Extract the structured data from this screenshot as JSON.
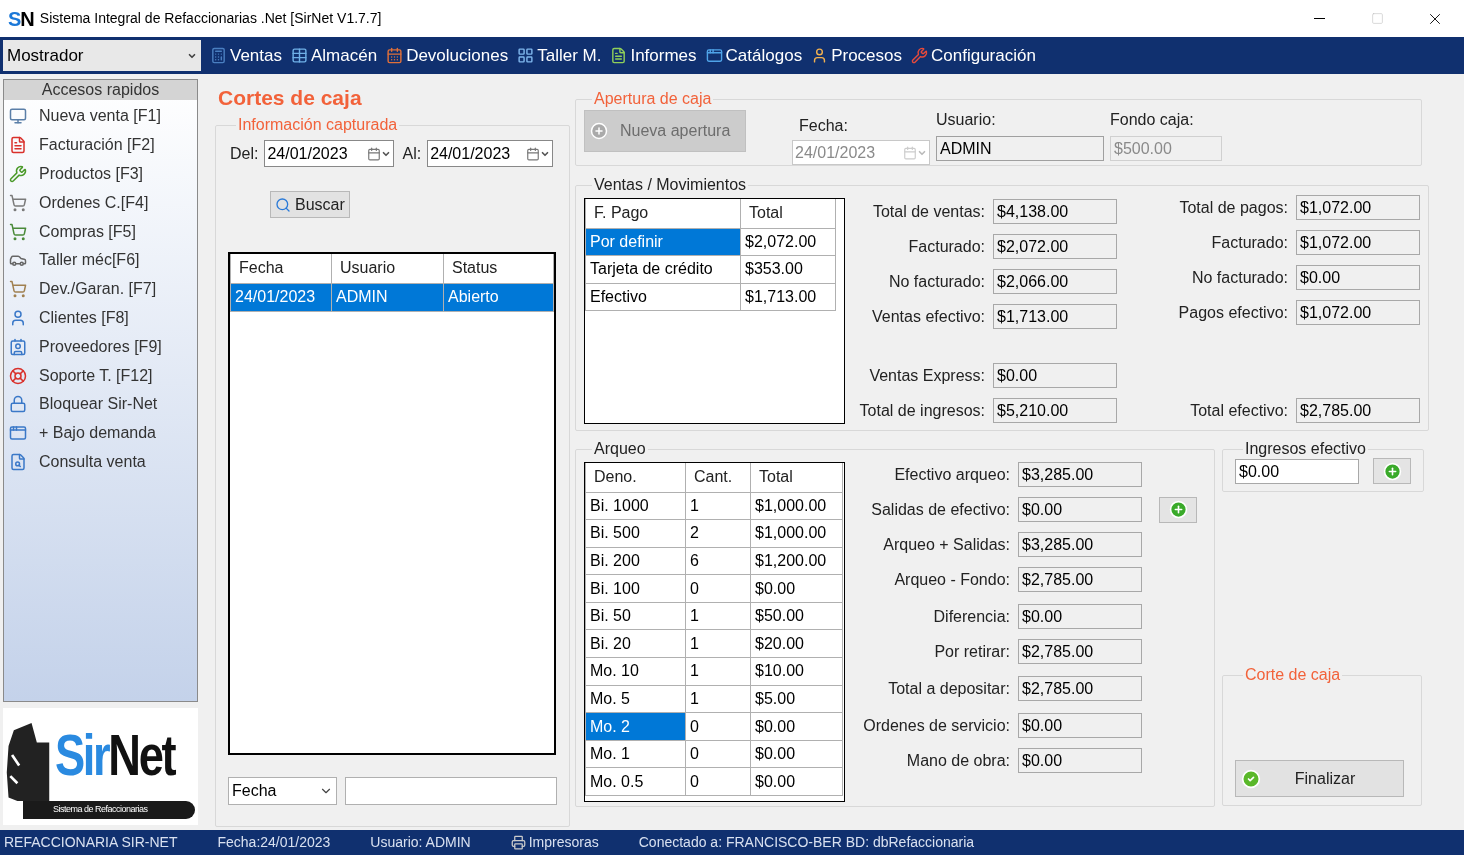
{
  "window": {
    "icon_letters": "SN",
    "title": "Sistema Integral de Refaccionarias .Net [SirNet V1.7.7]"
  },
  "menu": {
    "selector": "Mostrador",
    "items": [
      "Ventas",
      "Almacén",
      "Devoluciones",
      "Taller M.",
      "Informes",
      "Catálogos",
      "Procesos",
      "Configuración"
    ]
  },
  "sidebar": {
    "header": "Accesos rapidos",
    "items": [
      "Nueva venta [F1]",
      "Facturación [F2]",
      "Productos [F3]",
      "Ordenes C.[F4]",
      "Compras [F5]",
      "Taller méc[F6]",
      "Dev./Garan. [F7]",
      "Clientes [F8]",
      "Proveedores [F9]",
      "Soporte T. [F12]",
      "Bloquear Sir-Net",
      "+ Bajo demanda",
      "Consulta venta"
    ],
    "logo": {
      "brand_start": "Sir",
      "brand_end": "Net",
      "tagline": "Sistema de Refaccionarias"
    }
  },
  "cortes": {
    "title": "Cortes de caja",
    "group": "Información capturada",
    "from_label": "Del:",
    "from_value": "24/01/2023",
    "to_label": "Al:",
    "to_value": "24/01/2023",
    "search_button": "Buscar",
    "table": {
      "columns": [
        "Fecha",
        "Usuario",
        "Status"
      ],
      "rows": [
        {
          "cells": [
            "24/01/2023",
            "ADMIN",
            "Abierto"
          ],
          "selected": true
        }
      ]
    },
    "filter": {
      "field": "Fecha"
    }
  },
  "apertura": {
    "title": "Apertura de caja",
    "button": {
      "label": "Nueva apertura",
      "disabled": true
    },
    "fields": [
      {
        "label": "Fecha:",
        "value": "24/01/2023",
        "kind": "date",
        "disabled": true
      },
      {
        "label": "Usuario:",
        "value": "ADMIN",
        "kind": "text",
        "disabled": false
      },
      {
        "label": "Fondo caja:",
        "value": "$500.00",
        "kind": "text",
        "disabled": true
      }
    ]
  },
  "ventas": {
    "title": "Ventas / Movimientos",
    "table": {
      "columns": [
        "F. Pago",
        "Total"
      ],
      "rows": [
        {
          "cells": [
            "Por definir",
            "$2,072.00"
          ],
          "selected": true
        },
        {
          "cells": [
            "Tarjeta de crédito",
            "$353.00"
          ],
          "selected": false
        },
        {
          "cells": [
            "Efectivo",
            "$1,713.00"
          ],
          "selected": false
        }
      ]
    },
    "left": [
      [
        {
          "label": "Total de ventas:",
          "value": "$4,138.00"
        },
        {
          "label": "Facturado:",
          "value": "$2,072.00"
        },
        {
          "label": "No facturado:",
          "value": "$2,066.00"
        },
        {
          "label": "Ventas efectivo:",
          "value": "$1,713.00"
        }
      ],
      [
        {
          "label": "Ventas Express:",
          "value": "$0.00"
        },
        {
          "label": "Total de ingresos:",
          "value": "$5,210.00"
        }
      ]
    ],
    "right": [
      [
        {
          "label": "Total de pagos:",
          "value": "$1,072.00"
        },
        {
          "label": "Facturado:",
          "value": "$1,072.00"
        },
        {
          "label": "No facturado:",
          "value": "$0.00"
        },
        {
          "label": "Pagos efectivo:",
          "value": "$1,072.00"
        }
      ],
      [
        {
          "label": "Total efectivo:",
          "value": "$2,785.00"
        }
      ]
    ]
  },
  "arqueo": {
    "title": "Arqueo",
    "table": {
      "columns": [
        "Deno.",
        "Cant.",
        "Total"
      ],
      "rows": [
        {
          "cells": [
            "Bi. 1000",
            "1",
            "$1,000.00"
          ],
          "selected": false
        },
        {
          "cells": [
            "Bi. 500",
            "2",
            "$1,000.00"
          ],
          "selected": false
        },
        {
          "cells": [
            "Bi. 200",
            "6",
            "$1,200.00"
          ],
          "selected": false
        },
        {
          "cells": [
            "Bi. 100",
            "0",
            "$0.00"
          ],
          "selected": false
        },
        {
          "cells": [
            "Bi. 50",
            "1",
            "$50.00"
          ],
          "selected": false
        },
        {
          "cells": [
            "Bi. 20",
            "1",
            "$20.00"
          ],
          "selected": false
        },
        {
          "cells": [
            "Mo. 10",
            "1",
            "$10.00"
          ],
          "selected": false
        },
        {
          "cells": [
            "Mo. 5",
            "1",
            "$5.00"
          ],
          "selected": false
        },
        {
          "cells": [
            "Mo. 2",
            "0",
            "$0.00"
          ],
          "selected": true
        },
        {
          "cells": [
            "Mo. 1",
            "0",
            "$0.00"
          ],
          "selected": false
        },
        {
          "cells": [
            "Mo. 0.5",
            "0",
            "$0.00"
          ],
          "selected": false
        }
      ]
    },
    "fields": [
      [
        {
          "label": "Efectivo arqueo:",
          "value": "$3,285.00",
          "add_button": false
        },
        {
          "label": "Salidas de efectivo:",
          "value": "$0.00",
          "add_button": true
        },
        {
          "label": "Arqueo + Salidas:",
          "value": "$3,285.00",
          "add_button": false
        },
        {
          "label": "Arqueo - Fondo:",
          "value": "$2,785.00",
          "add_button": false
        }
      ],
      [
        {
          "label": "Diferencia:",
          "value": "$0.00",
          "add_button": false
        },
        {
          "label": "Por retirar:",
          "value": "$2,785.00",
          "add_button": false
        }
      ],
      [
        {
          "label": "Total a depositar:",
          "value": "$2,785.00",
          "add_button": false
        }
      ],
      [
        {
          "label": "Ordenes de servicio:",
          "value": "$0.00",
          "add_button": false
        },
        {
          "label": "Mano de obra:",
          "value": "$0.00",
          "add_button": false
        }
      ]
    ]
  },
  "ingresos": {
    "title": "Ingresos efectivo",
    "value": "$0.00"
  },
  "corte": {
    "title": "Corte de caja",
    "button": "Finalizar"
  },
  "status_bar": [
    {
      "kind": "text",
      "text": "REFACCIONARIA SIR-NET"
    },
    {
      "kind": "text",
      "text": "Fecha:24/01/2023"
    },
    {
      "kind": "text",
      "text": "Usuario: ADMIN"
    },
    {
      "kind": "printers",
      "text": "Impresoras"
    },
    {
      "kind": "text",
      "text": "Conectado a: FRANCISCO-BER BD: dbRefaccionaria"
    }
  ]
}
